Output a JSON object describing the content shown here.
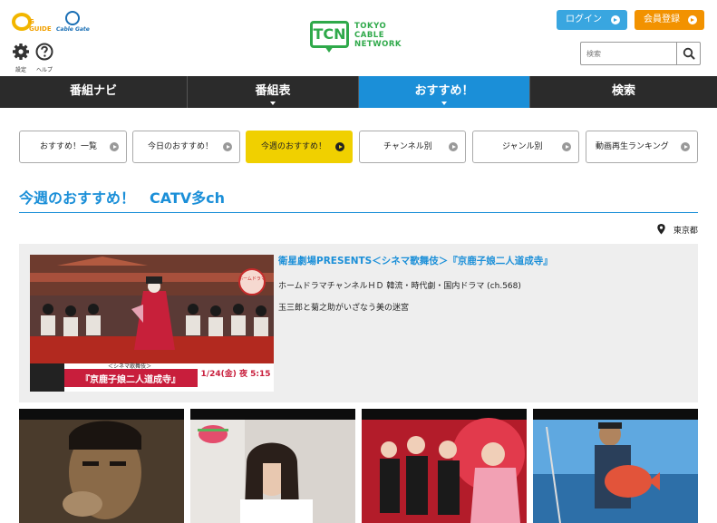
{
  "header": {
    "gguide_logo": "G GUIDE",
    "cablegate_logo": "Cable Gate",
    "utility": [
      {
        "label": "設定",
        "icon": "gear-icon"
      },
      {
        "label": "ヘルプ",
        "icon": "help-icon"
      }
    ],
    "brand_logo_text": [
      "TOKYO",
      "CABLE",
      "NETWORK"
    ],
    "brand_logo_mark": "TCN",
    "login_label": "ログイン",
    "register_label": "会員登録",
    "search_placeholder": "検索"
  },
  "nav": {
    "items": [
      {
        "label": "番組ナビ",
        "active": false,
        "has_caret": false
      },
      {
        "label": "番組表",
        "active": false,
        "has_caret": true
      },
      {
        "label": "おすすめ！",
        "active": true,
        "has_caret": true
      },
      {
        "label": "検索",
        "active": false,
        "has_caret": false
      }
    ]
  },
  "subtabs": [
    {
      "label": "おすすめ！一覧",
      "active": false
    },
    {
      "label": "今日のおすすめ！",
      "active": false
    },
    {
      "label": "今週のおすすめ！",
      "active": true
    },
    {
      "label": "チャンネル別",
      "active": false
    },
    {
      "label": "ジャンル別",
      "active": false
    },
    {
      "label": "動画再生ランキング",
      "active": false
    }
  ],
  "page_title": "今週のおすすめ！　CATV多ch",
  "region": "東京都",
  "featured": {
    "title": "衛星劇場PRESENTS＜シネマ歌舞伎＞『京鹿子娘二人道成寺』",
    "channel": "ホームドラマチャンネルＨＤ 韓流・時代劇・国内ドラマ (ch.568)",
    "description": "玉三郎と菊之助がいざなう美の迷宮",
    "image_caption_small": "＜シネマ歌舞伎＞",
    "image_caption": "『京鹿子娘二人道成寺』",
    "image_date": "1/24(金) 夜 5:15",
    "image_badge": "ホームドラマ"
  },
  "colors": {
    "accent_blue": "#1b8fd8",
    "nav_bg": "#2b2b2b",
    "active_tab": "#f0d000",
    "login": "#39a6e0",
    "register": "#f29200",
    "brand_green": "#2fa94a"
  }
}
